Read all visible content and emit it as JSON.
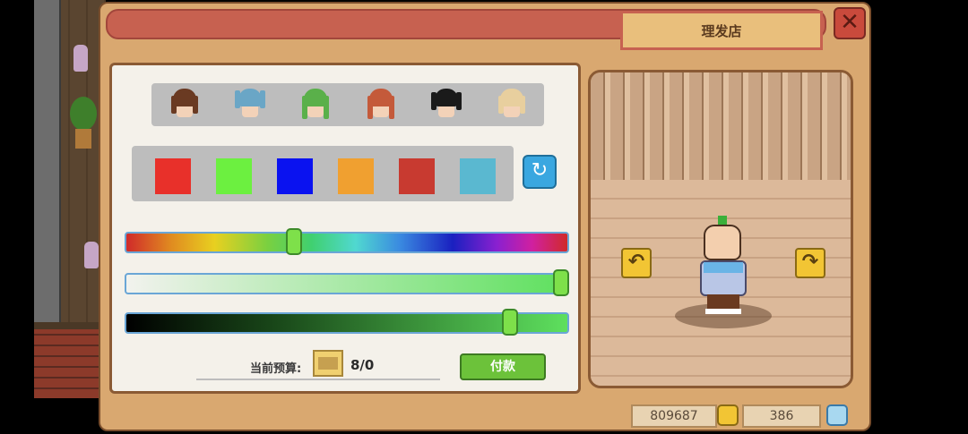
{
  "window": {
    "title": "理发店",
    "close_icon": "close-icon"
  },
  "hair_styles": [
    {
      "name": "hair-brown-bob",
      "color": "#6a3a22"
    },
    {
      "name": "hair-teal-pigtails",
      "color": "#6aa6c6"
    },
    {
      "name": "hair-green-long",
      "color": "#5ab04a"
    },
    {
      "name": "hair-auburn-long",
      "color": "#c45a3a"
    },
    {
      "name": "hair-black-pigtails",
      "color": "#1a1a1a"
    },
    {
      "name": "hair-blonde-bob",
      "color": "#e8cf9e"
    }
  ],
  "color_swatches": [
    "#e8302a",
    "#6cf040",
    "#0a12f0",
    "#f0a030",
    "#c83a30",
    "#5ab8d0"
  ],
  "refresh_icon": "refresh-icon",
  "sliders": {
    "hue": 0.38,
    "saturation": 1.0,
    "brightness": 0.87
  },
  "budget": {
    "label": "当前预算:",
    "value": "8/0",
    "icon": "ticket-icon"
  },
  "pay_button": "付款",
  "preview": {
    "left_arrow": "rotate-left-icon",
    "right_arrow": "rotate-right-icon"
  },
  "currency": {
    "gold": "809687",
    "gold_icon": "gold-coin-icon",
    "gems": "386",
    "gems_icon": "gem-icon"
  }
}
